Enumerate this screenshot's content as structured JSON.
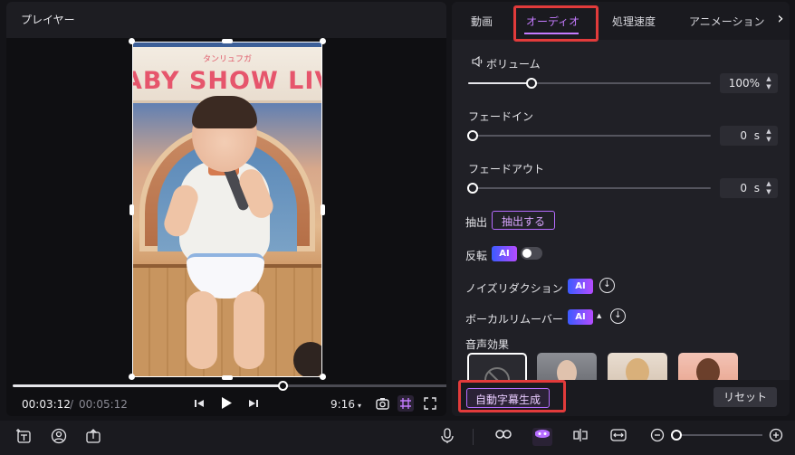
{
  "player": {
    "title": "プレイヤー",
    "banner_small": "タンリュフガ",
    "banner_main": "ABY SHOW LIV",
    "progress": 0.61,
    "time_current": "00:03:12",
    "time_separator": "/",
    "time_total": "00:05:12",
    "aspect_ratio": "9:16",
    "icons": [
      "prev-frame-icon",
      "play-icon",
      "next-frame-icon",
      "chevron-down-icon",
      "snapshot-icon",
      "grid-icon",
      "fullscreen-icon"
    ]
  },
  "panel": {
    "tabs": [
      "動画",
      "オーディオ",
      "処理速度",
      "アニメーション"
    ],
    "active_tab": "オーディオ",
    "volume": {
      "label": "ボリューム",
      "value": "100%",
      "level": 0.27
    },
    "fade_in": {
      "label": "フェードイン",
      "value": "0",
      "unit": "s",
      "level": 0
    },
    "fade_out": {
      "label": "フェードアウト",
      "value": "0",
      "unit": "s",
      "level": 0
    },
    "extract": {
      "label": "抽出",
      "button": "抽出する"
    },
    "reverse": {
      "label": "反転",
      "ai": "AI",
      "enabled": false
    },
    "noise_reduction": {
      "label": "ノイズリダクション",
      "ai": "AI"
    },
    "vocal_remover": {
      "label": "ボーカルリムーバー",
      "ai": "AI"
    },
    "voice_effects": {
      "label": "音声効果"
    },
    "auto_caption_button": "自動字幕生成",
    "reset_button": "リセット"
  },
  "colors": {
    "accent": "#c57bff",
    "highlight": "#e23b3b",
    "panel_bg": "#202026"
  },
  "toolbar": {
    "icons": [
      "text-add-icon",
      "face-icon",
      "export-icon",
      "microphone-icon",
      "link-icon",
      "ai-mask-icon",
      "split-icon",
      "fit-icon",
      "zoom-out-icon",
      "zoom-in-icon"
    ],
    "zoom_level": 0.05
  }
}
